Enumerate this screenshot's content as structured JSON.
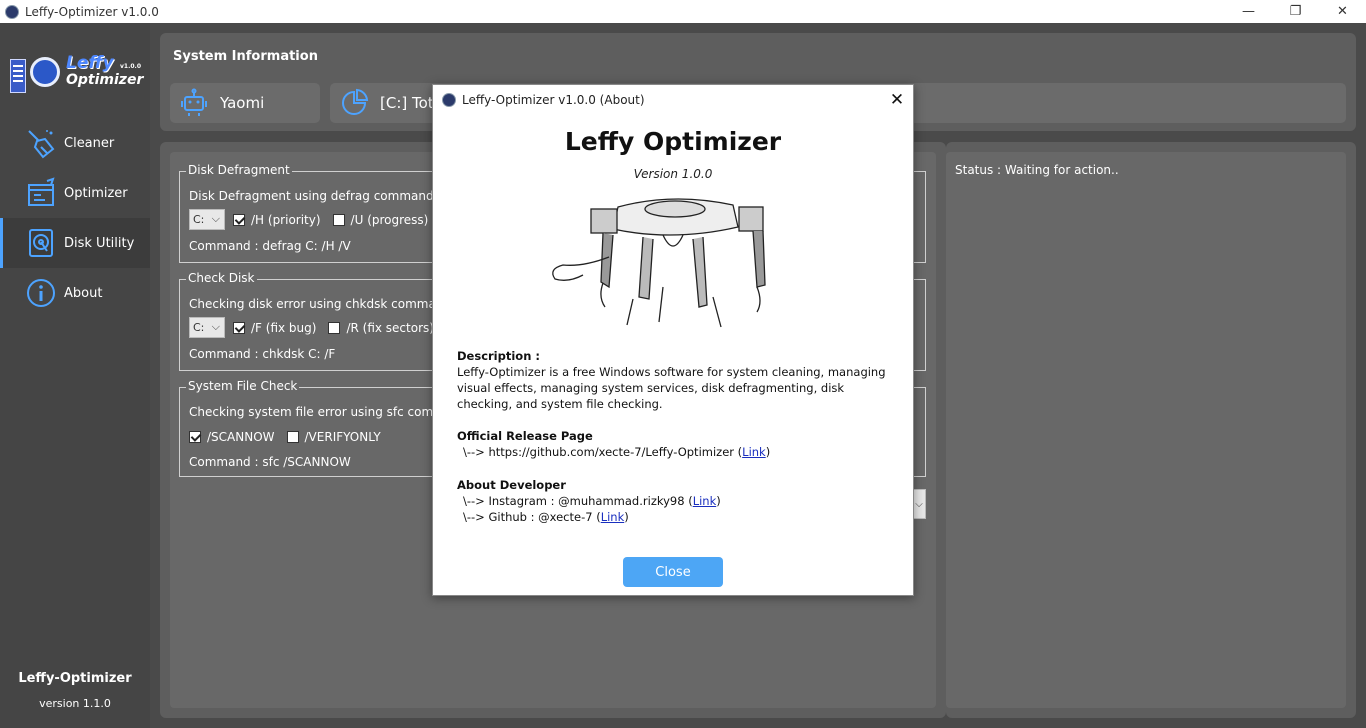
{
  "window": {
    "title": "Leffy-Optimizer v1.0.0",
    "controls": {
      "minimize": "—",
      "restore": "❐",
      "close": "✕"
    }
  },
  "sidebar": {
    "logo": {
      "line1": "Leffy",
      "line2": "Optimizer",
      "version_mark": "v1.0.0"
    },
    "items": [
      {
        "label": "Cleaner",
        "icon": "broom-icon"
      },
      {
        "label": "Optimizer",
        "icon": "gauge-icon"
      },
      {
        "label": "Disk Utility",
        "icon": "disk-icon",
        "active": true
      },
      {
        "label": "About",
        "icon": "info-icon"
      }
    ],
    "footer_app": "Leffy-Optimizer",
    "footer_version": "version 1.1.0"
  },
  "system_info": {
    "title": "System Information",
    "user_card": "Yaomi",
    "disk_card": "[C:] Tota"
  },
  "disk_defrag": {
    "title": "Disk Defragment",
    "description": "Disk Defragment using defrag command",
    "drive": "C:",
    "options": [
      {
        "label": "/H (priority)",
        "checked": true
      },
      {
        "label": "/U (progress)",
        "checked": false
      }
    ],
    "command": "Command : defrag C: /H /V"
  },
  "check_disk": {
    "title": "Check Disk",
    "description": "Checking disk error using chkdsk command",
    "drive": "C:",
    "options": [
      {
        "label": "/F (fix bug)",
        "checked": true
      },
      {
        "label": "/R (fix sectors)",
        "checked": false
      }
    ],
    "command": "Command : chkdsk C: /F"
  },
  "sfc": {
    "title": "System File Check",
    "description": "Checking system file error using sfc command",
    "options": [
      {
        "label": "/SCANNOW",
        "checked": true
      },
      {
        "label": "/VERIFYONLY",
        "checked": false
      }
    ],
    "command": "Command : sfc /SCANNOW"
  },
  "status": {
    "text": "Status : Waiting for action.."
  },
  "about_dialog": {
    "title": "Leffy-Optimizer v1.0.0 (About)",
    "heading": "Leffy Optimizer",
    "version": "Version 1.0.0",
    "description_label": "Description :",
    "description_text": "Leffy-Optimizer is a free Windows software for system cleaning, managing visual effects, managing system services, disk defragmenting, disk checking, and system file checking.",
    "release_label": "Official Release Page",
    "release_text": "\\--> https://github.com/xecte-7/Leffy-Optimizer (",
    "release_link": "Link",
    "developer_label": "About Developer",
    "instagram_text": "\\--> Instagram : @muhammad.rizky98 (",
    "instagram_link": "Link",
    "github_text": "\\--> Github : @xecte-7 (",
    "github_link": "Link",
    "close_label": "Close",
    "close_x": "✕"
  },
  "colors": {
    "accent": "#4da3ff",
    "close_button": "#4da6f5",
    "link": "#1a2fbf"
  }
}
